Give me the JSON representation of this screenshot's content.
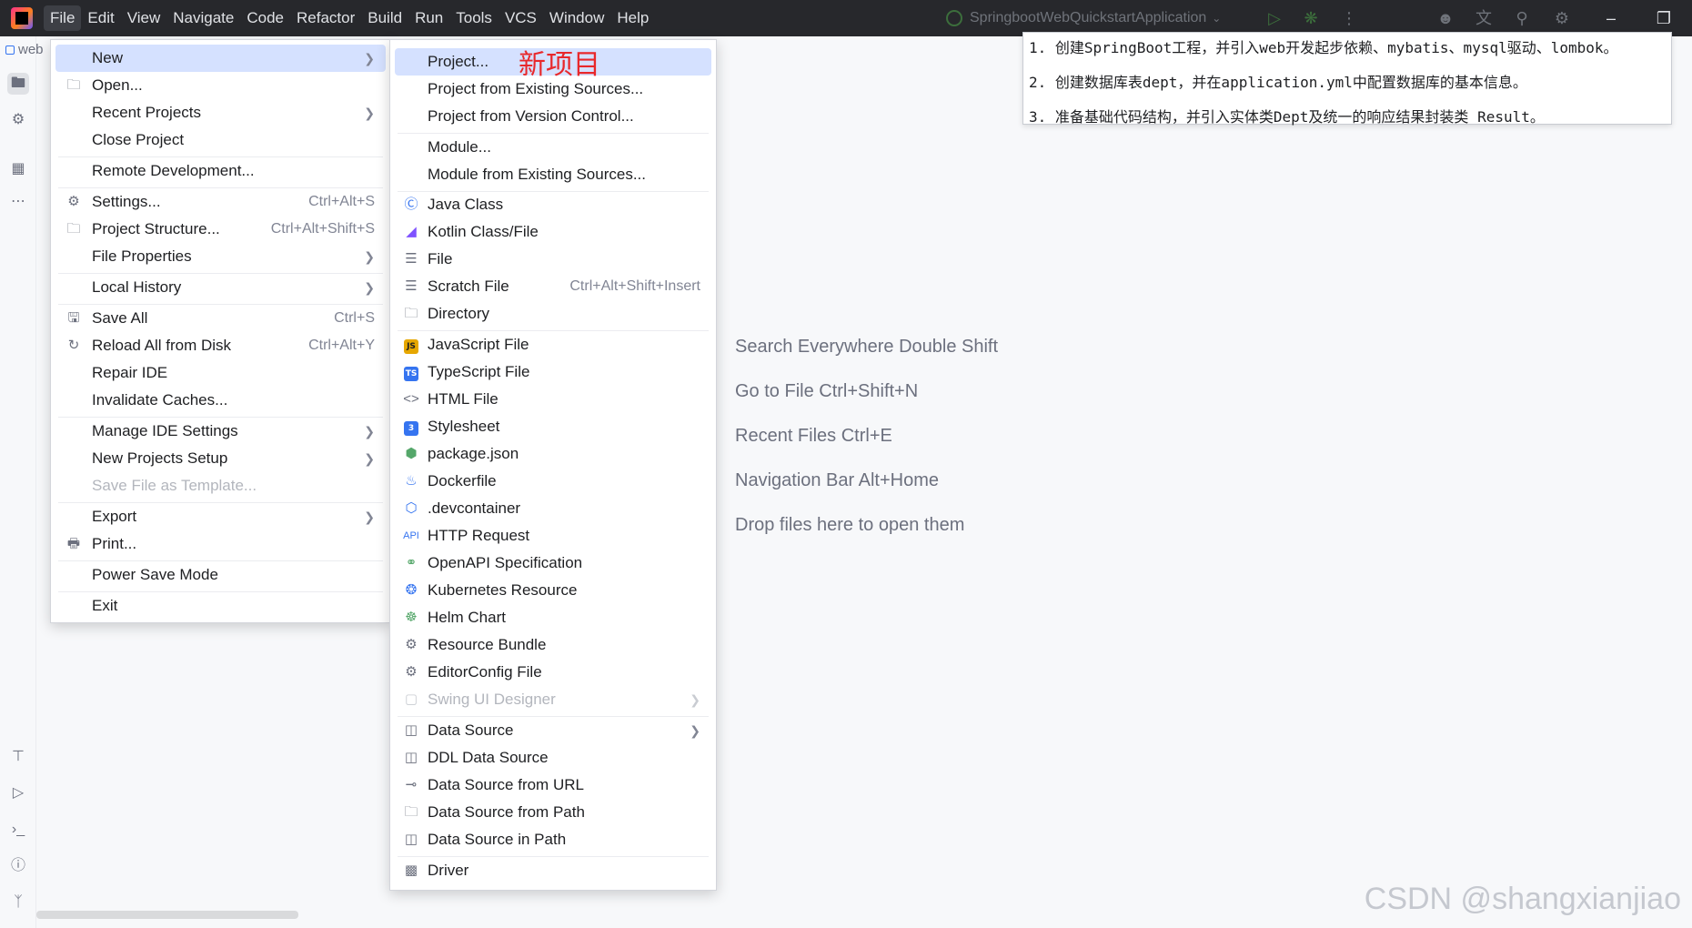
{
  "titlebar": {
    "menus": [
      "File",
      "Edit",
      "View",
      "Navigate",
      "Code",
      "Refactor",
      "Build",
      "Run",
      "Tools",
      "VCS",
      "Window",
      "Help"
    ],
    "run_config": "SpringbootWebQuickstartApplication"
  },
  "project_tab": "web",
  "file_menu": {
    "items": [
      {
        "label": "New",
        "shortcut": "",
        "submenu": true,
        "icon": ""
      },
      {
        "label": "Open...",
        "shortcut": "",
        "submenu": false,
        "icon": "folder-icon"
      },
      {
        "label": "Recent Projects",
        "shortcut": "",
        "submenu": true,
        "icon": ""
      },
      {
        "label": "Close Project",
        "shortcut": "",
        "submenu": false,
        "icon": ""
      },
      {
        "label": "Remote Development...",
        "shortcut": "",
        "submenu": false,
        "icon": ""
      },
      {
        "label": "Settings...",
        "shortcut": "Ctrl+Alt+S",
        "submenu": false,
        "icon": "gear-icon"
      },
      {
        "label": "Project Structure...",
        "shortcut": "Ctrl+Alt+Shift+S",
        "submenu": false,
        "icon": "project-structure-icon"
      },
      {
        "label": "File Properties",
        "shortcut": "",
        "submenu": true,
        "icon": ""
      },
      {
        "label": "Local History",
        "shortcut": "",
        "submenu": true,
        "icon": ""
      },
      {
        "label": "Save All",
        "shortcut": "Ctrl+S",
        "submenu": false,
        "icon": "save-icon"
      },
      {
        "label": "Reload All from Disk",
        "shortcut": "Ctrl+Alt+Y",
        "submenu": false,
        "icon": "reload-icon"
      },
      {
        "label": "Repair IDE",
        "shortcut": "",
        "submenu": false,
        "icon": ""
      },
      {
        "label": "Invalidate Caches...",
        "shortcut": "",
        "submenu": false,
        "icon": ""
      },
      {
        "label": "Manage IDE Settings",
        "shortcut": "",
        "submenu": true,
        "icon": ""
      },
      {
        "label": "New Projects Setup",
        "shortcut": "",
        "submenu": true,
        "icon": ""
      },
      {
        "label": "Save File as Template...",
        "shortcut": "",
        "submenu": false,
        "icon": "",
        "disabled": true
      },
      {
        "label": "Export",
        "shortcut": "",
        "submenu": true,
        "icon": ""
      },
      {
        "label": "Print...",
        "shortcut": "",
        "submenu": false,
        "icon": "print-icon"
      },
      {
        "label": "Power Save Mode",
        "shortcut": "",
        "submenu": false,
        "icon": ""
      },
      {
        "label": "Exit",
        "shortcut": "",
        "submenu": false,
        "icon": ""
      }
    ]
  },
  "new_menu": {
    "items": [
      {
        "label": "Project...",
        "shortcut": "",
        "icon": ""
      },
      {
        "label": "Project from Existing Sources...",
        "shortcut": "",
        "icon": ""
      },
      {
        "label": "Project from Version Control...",
        "shortcut": "",
        "icon": ""
      },
      {
        "label": "Module...",
        "shortcut": "",
        "icon": ""
      },
      {
        "label": "Module from Existing Sources...",
        "shortcut": "",
        "icon": ""
      },
      {
        "label": "Java Class",
        "shortcut": "",
        "icon": "java-class-icon"
      },
      {
        "label": "Kotlin Class/File",
        "shortcut": "",
        "icon": "kotlin-icon"
      },
      {
        "label": "File",
        "shortcut": "",
        "icon": "file-icon"
      },
      {
        "label": "Scratch File",
        "shortcut": "Ctrl+Alt+Shift+Insert",
        "icon": "scratch-file-icon"
      },
      {
        "label": "Directory",
        "shortcut": "",
        "icon": "folder-icon"
      },
      {
        "label": "JavaScript File",
        "shortcut": "",
        "icon": "javascript-icon"
      },
      {
        "label": "TypeScript File",
        "shortcut": "",
        "icon": "typescript-icon"
      },
      {
        "label": "HTML File",
        "shortcut": "",
        "icon": "html-icon"
      },
      {
        "label": "Stylesheet",
        "shortcut": "",
        "icon": "css-icon"
      },
      {
        "label": "package.json",
        "shortcut": "",
        "icon": "npm-icon"
      },
      {
        "label": "Dockerfile",
        "shortcut": "",
        "icon": "docker-icon"
      },
      {
        "label": ".devcontainer",
        "shortcut": "",
        "icon": "devcontainer-icon"
      },
      {
        "label": "HTTP Request",
        "shortcut": "",
        "icon": "api-icon"
      },
      {
        "label": "OpenAPI Specification",
        "shortcut": "",
        "icon": "openapi-icon"
      },
      {
        "label": "Kubernetes Resource",
        "shortcut": "",
        "icon": "kubernetes-icon"
      },
      {
        "label": "Helm Chart",
        "shortcut": "",
        "icon": "helm-icon"
      },
      {
        "label": "Resource Bundle",
        "shortcut": "",
        "icon": "resource-bundle-icon"
      },
      {
        "label": "EditorConfig File",
        "shortcut": "",
        "icon": "editorconfig-icon"
      },
      {
        "label": "Swing UI Designer",
        "shortcut": "",
        "icon": "swing-icon",
        "disabled": true
      },
      {
        "label": "Data Source",
        "shortcut": "",
        "icon": "database-icon"
      },
      {
        "label": "DDL Data Source",
        "shortcut": "",
        "icon": "ddl-icon"
      },
      {
        "label": "Data Source from URL",
        "shortcut": "",
        "icon": "url-icon"
      },
      {
        "label": "Data Source from Path",
        "shortcut": "",
        "icon": "folder-icon"
      },
      {
        "label": "Data Source in Path",
        "shortcut": "",
        "icon": "database-icon"
      },
      {
        "label": "Driver",
        "shortcut": "",
        "icon": "driver-icon"
      }
    ]
  },
  "annotation": "新项目",
  "notes": [
    "1. 创建SpringBoot工程，并引入web开发起步依赖、mybatis、mysql驱动、lombok。",
    "2. 创建数据库表dept，并在application.yml中配置数据库的基本信息。",
    "3. 准备基础代码结构，并引入实体类Dept及统一的响应结果封装类 Result。"
  ],
  "editor_hints": [
    "Search Everywhere Double Shift",
    "Go to File Ctrl+Shift+N",
    "Recent Files Ctrl+E",
    "Navigation Bar Alt+Home",
    "Drop files here to open them"
  ],
  "watermark": "CSDN @shangxianjiao",
  "colors": {
    "accent": "#3574f0",
    "selection": "#d5e1ff",
    "annotation_red": "#e8282b",
    "titlebar": "#27282c"
  }
}
